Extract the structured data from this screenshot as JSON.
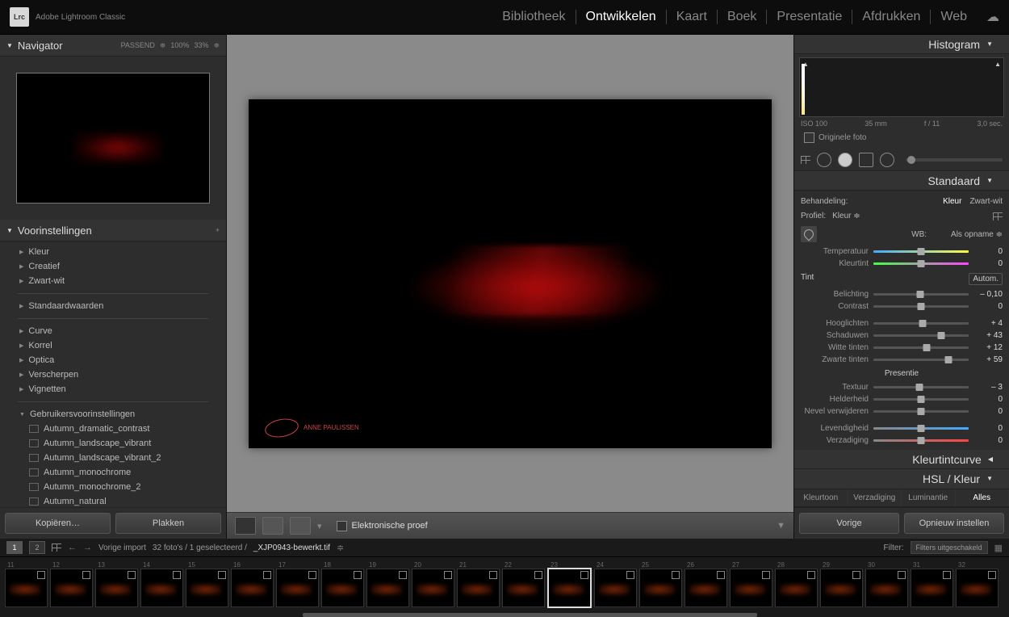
{
  "app": {
    "title": "Adobe Lightroom Classic",
    "logo": "Lrc"
  },
  "topnav": {
    "items": [
      "Bibliotheek",
      "Ontwikkelen",
      "Kaart",
      "Boek",
      "Presentatie",
      "Afdrukken",
      "Web"
    ],
    "active": 1
  },
  "navigator": {
    "title": "Navigator",
    "fit": "PASSEND",
    "z1": "100%",
    "z2": "33%"
  },
  "presets": {
    "title": "Voorinstellingen",
    "groups": [
      "Kleur",
      "Creatief",
      "Zwart-wit"
    ],
    "groups2": [
      "Standaardwaarden"
    ],
    "groups3": [
      "Curve",
      "Korrel",
      "Optica",
      "Verscherpen",
      "Vignetten"
    ],
    "user_head": "Gebruikersvoorinstellingen",
    "user": [
      "Autumn_dramatic_contrast",
      "Autumn_landscape_vibrant",
      "Autumn_landscape_vibrant_2",
      "Autumn_monochrome",
      "Autumn_monochrome_2",
      "Autumn_natural"
    ]
  },
  "buttons": {
    "copy": "Kopiëren…",
    "paste": "Plakken"
  },
  "center": {
    "proof": "Elektronische proef",
    "signature": "ANNE PAULISSEN"
  },
  "right": {
    "histogram": "Histogram",
    "meta": {
      "iso": "ISO 100",
      "focal": "35 mm",
      "ap": "f / 11",
      "sh": "3,0 sec."
    },
    "orig": "Originele foto",
    "standard": "Standaard",
    "treat": {
      "label": "Behandeling:",
      "color": "Kleur",
      "bw": "Zwart-wit"
    },
    "profile": {
      "label": "Profiel:",
      "value": "Kleur"
    },
    "wb": {
      "label": "WB:",
      "value": "Als opname"
    },
    "sliders": {
      "temp": {
        "label": "Temperatuur",
        "val": "0",
        "pos": 50
      },
      "tint": {
        "label": "Kleurtint",
        "val": "0",
        "pos": 50
      },
      "sect_tone": "Tint",
      "auto": "Autom.",
      "exp": {
        "label": "Belichting",
        "val": "– 0,10",
        "pos": 49
      },
      "con": {
        "label": "Contrast",
        "val": "0",
        "pos": 50
      },
      "hi": {
        "label": "Hooglichten",
        "val": "+ 4",
        "pos": 52
      },
      "sh": {
        "label": "Schaduwen",
        "val": "+ 43",
        "pos": 71
      },
      "wh": {
        "label": "Witte tinten",
        "val": "+ 12",
        "pos": 56
      },
      "bl": {
        "label": "Zwarte tinten",
        "val": "+ 59",
        "pos": 79
      },
      "sect_pres": "Presentie",
      "tex": {
        "label": "Textuur",
        "val": "– 3",
        "pos": 48
      },
      "cla": {
        "label": "Helderheid",
        "val": "0",
        "pos": 50
      },
      "dh": {
        "label": "Nevel verwijderen",
        "val": "0",
        "pos": 50
      },
      "vib": {
        "label": "Levendigheid",
        "val": "0",
        "pos": 50
      },
      "sat": {
        "label": "Verzadiging",
        "val": "0",
        "pos": 50
      }
    },
    "tonecurve": "Kleurtintcurve",
    "hsl": "HSL / Kleur",
    "hsl_tabs": {
      "hue": "Kleurtoon",
      "sat": "Verzadiging",
      "lum": "Luminantie",
      "all": "Alles"
    },
    "prev": "Vorige",
    "reset": "Opnieuw instellen"
  },
  "bottom": {
    "pages": [
      "1",
      "2"
    ],
    "prev_import": "Vorige import",
    "count": "32 foto's / 1 geselecteerd /",
    "filename": "_XJP0943-bewerkt.tif",
    "filter_label": "Filter:",
    "filter_value": "Filters uitgeschakeld",
    "thumbs": [
      11,
      12,
      13,
      14,
      15,
      16,
      17,
      18,
      19,
      20,
      21,
      22,
      23,
      24,
      25,
      26,
      27,
      28,
      29,
      30,
      31,
      32
    ],
    "selected": 23
  }
}
